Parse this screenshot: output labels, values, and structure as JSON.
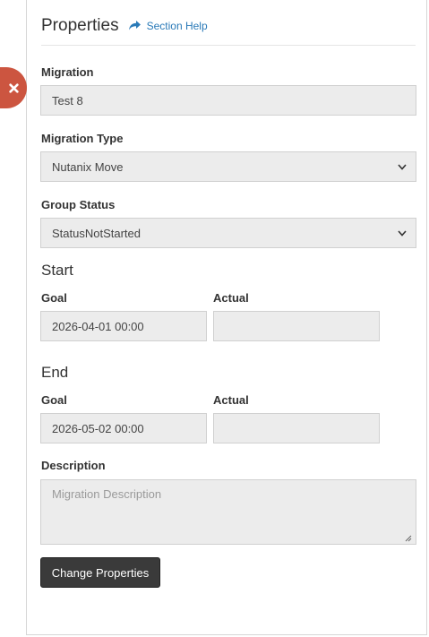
{
  "header": {
    "title": "Properties",
    "help_label": "Section Help"
  },
  "close_button": {
    "icon": "close-icon",
    "color": "#cc5540"
  },
  "migration": {
    "label": "Migration",
    "value": "Test 8"
  },
  "migration_type": {
    "label": "Migration Type",
    "selected": "Nutanix Move"
  },
  "group_status": {
    "label": "Group Status",
    "selected": "StatusNotStarted"
  },
  "start": {
    "title": "Start",
    "goal_label": "Goal",
    "goal_value": "2026-04-01 00:00",
    "actual_label": "Actual",
    "actual_value": ""
  },
  "end": {
    "title": "End",
    "goal_label": "Goal",
    "goal_value": "2026-05-02 00:00",
    "actual_label": "Actual",
    "actual_value": ""
  },
  "description": {
    "label": "Description",
    "placeholder": "Migration Description",
    "value": ""
  },
  "submit": {
    "label": "Change Properties"
  },
  "colors": {
    "accent_link": "#2a7ab8",
    "button_bg": "#3a3a3a",
    "field_bg": "#ececec"
  }
}
